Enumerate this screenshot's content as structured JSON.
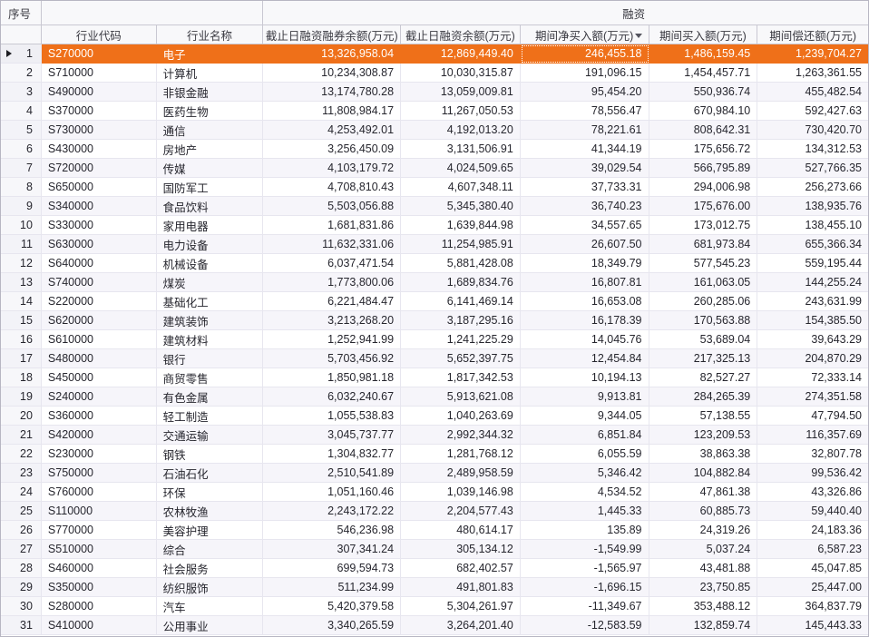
{
  "header": {
    "index_label": "序号",
    "financing_band_label": "融资",
    "columns": [
      {
        "label": "行业代码"
      },
      {
        "label": "行业名称"
      },
      {
        "label": "截止日融资融券余额(万元)"
      },
      {
        "label": "截止日融资余额(万元)"
      },
      {
        "label": "期间净买入额(万元)",
        "sort": "desc"
      },
      {
        "label": "期间买入额(万元)"
      },
      {
        "label": "期间偿还额(万元)"
      }
    ]
  },
  "colors": {
    "selection": "#ef7019",
    "alt_row_bg": "#f6f5fa",
    "header_bg": "#f8f8fa",
    "header_border": "#c9c8d2",
    "grid_line": "#e7e6ef"
  },
  "table": {
    "selected_row": 1,
    "focused_column_index": 4,
    "rows": [
      {
        "no": 1,
        "code": "S270000",
        "name": "电子",
        "v": [
          "13,326,958.04",
          "12,869,449.40",
          "246,455.18",
          "1,486,159.45",
          "1,239,704.27"
        ]
      },
      {
        "no": 2,
        "code": "S710000",
        "name": "计算机",
        "v": [
          "10,234,308.87",
          "10,030,315.87",
          "191,096.15",
          "1,454,457.71",
          "1,263,361.55"
        ]
      },
      {
        "no": 3,
        "code": "S490000",
        "name": "非银金融",
        "v": [
          "13,174,780.28",
          "13,059,009.81",
          "95,454.20",
          "550,936.74",
          "455,482.54"
        ]
      },
      {
        "no": 4,
        "code": "S370000",
        "name": "医药生物",
        "v": [
          "11,808,984.17",
          "11,267,050.53",
          "78,556.47",
          "670,984.10",
          "592,427.63"
        ]
      },
      {
        "no": 5,
        "code": "S730000",
        "name": "通信",
        "v": [
          "4,253,492.01",
          "4,192,013.20",
          "78,221.61",
          "808,642.31",
          "730,420.70"
        ]
      },
      {
        "no": 6,
        "code": "S430000",
        "name": "房地产",
        "v": [
          "3,256,450.09",
          "3,131,506.91",
          "41,344.19",
          "175,656.72",
          "134,312.53"
        ]
      },
      {
        "no": 7,
        "code": "S720000",
        "name": "传媒",
        "v": [
          "4,103,179.72",
          "4,024,509.65",
          "39,029.54",
          "566,795.89",
          "527,766.35"
        ]
      },
      {
        "no": 8,
        "code": "S650000",
        "name": "国防军工",
        "v": [
          "4,708,810.43",
          "4,607,348.11",
          "37,733.31",
          "294,006.98",
          "256,273.66"
        ]
      },
      {
        "no": 9,
        "code": "S340000",
        "name": "食品饮料",
        "v": [
          "5,503,056.88",
          "5,345,380.40",
          "36,740.23",
          "175,676.00",
          "138,935.76"
        ]
      },
      {
        "no": 10,
        "code": "S330000",
        "name": "家用电器",
        "v": [
          "1,681,831.86",
          "1,639,844.98",
          "34,557.65",
          "173,012.75",
          "138,455.10"
        ]
      },
      {
        "no": 11,
        "code": "S630000",
        "name": "电力设备",
        "v": [
          "11,632,331.06",
          "11,254,985.91",
          "26,607.50",
          "681,973.84",
          "655,366.34"
        ]
      },
      {
        "no": 12,
        "code": "S640000",
        "name": "机械设备",
        "v": [
          "6,037,471.54",
          "5,881,428.08",
          "18,349.79",
          "577,545.23",
          "559,195.44"
        ]
      },
      {
        "no": 13,
        "code": "S740000",
        "name": "煤炭",
        "v": [
          "1,773,800.06",
          "1,689,834.76",
          "16,807.81",
          "161,063.05",
          "144,255.24"
        ]
      },
      {
        "no": 14,
        "code": "S220000",
        "name": "基础化工",
        "v": [
          "6,221,484.47",
          "6,141,469.14",
          "16,653.08",
          "260,285.06",
          "243,631.99"
        ]
      },
      {
        "no": 15,
        "code": "S620000",
        "name": "建筑装饰",
        "v": [
          "3,213,268.20",
          "3,187,295.16",
          "16,178.39",
          "170,563.88",
          "154,385.50"
        ]
      },
      {
        "no": 16,
        "code": "S610000",
        "name": "建筑材料",
        "v": [
          "1,252,941.99",
          "1,241,225.29",
          "14,045.76",
          "53,689.04",
          "39,643.29"
        ]
      },
      {
        "no": 17,
        "code": "S480000",
        "name": "银行",
        "v": [
          "5,703,456.92",
          "5,652,397.75",
          "12,454.84",
          "217,325.13",
          "204,870.29"
        ]
      },
      {
        "no": 18,
        "code": "S450000",
        "name": "商贸零售",
        "v": [
          "1,850,981.18",
          "1,817,342.53",
          "10,194.13",
          "82,527.27",
          "72,333.14"
        ]
      },
      {
        "no": 19,
        "code": "S240000",
        "name": "有色金属",
        "v": [
          "6,032,240.67",
          "5,913,621.08",
          "9,913.81",
          "284,265.39",
          "274,351.58"
        ]
      },
      {
        "no": 20,
        "code": "S360000",
        "name": "轻工制造",
        "v": [
          "1,055,538.83",
          "1,040,263.69",
          "9,344.05",
          "57,138.55",
          "47,794.50"
        ]
      },
      {
        "no": 21,
        "code": "S420000",
        "name": "交通运输",
        "v": [
          "3,045,737.77",
          "2,992,344.32",
          "6,851.84",
          "123,209.53",
          "116,357.69"
        ]
      },
      {
        "no": 22,
        "code": "S230000",
        "name": "钢铁",
        "v": [
          "1,304,832.77",
          "1,281,768.12",
          "6,055.59",
          "38,863.38",
          "32,807.78"
        ]
      },
      {
        "no": 23,
        "code": "S750000",
        "name": "石油石化",
        "v": [
          "2,510,541.89",
          "2,489,958.59",
          "5,346.42",
          "104,882.84",
          "99,536.42"
        ]
      },
      {
        "no": 24,
        "code": "S760000",
        "name": "环保",
        "v": [
          "1,051,160.46",
          "1,039,146.98",
          "4,534.52",
          "47,861.38",
          "43,326.86"
        ]
      },
      {
        "no": 25,
        "code": "S110000",
        "name": "农林牧渔",
        "v": [
          "2,243,172.22",
          "2,204,577.43",
          "1,445.33",
          "60,885.73",
          "59,440.40"
        ]
      },
      {
        "no": 26,
        "code": "S770000",
        "name": "美容护理",
        "v": [
          "546,236.98",
          "480,614.17",
          "135.89",
          "24,319.26",
          "24,183.36"
        ]
      },
      {
        "no": 27,
        "code": "S510000",
        "name": "综合",
        "v": [
          "307,341.24",
          "305,134.12",
          "-1,549.99",
          "5,037.24",
          "6,587.23"
        ]
      },
      {
        "no": 28,
        "code": "S460000",
        "name": "社会服务",
        "v": [
          "699,594.73",
          "682,402.57",
          "-1,565.97",
          "43,481.88",
          "45,047.85"
        ]
      },
      {
        "no": 29,
        "code": "S350000",
        "name": "纺织服饰",
        "v": [
          "511,234.99",
          "491,801.83",
          "-1,696.15",
          "23,750.85",
          "25,447.00"
        ]
      },
      {
        "no": 30,
        "code": "S280000",
        "name": "汽车",
        "v": [
          "5,420,379.58",
          "5,304,261.97",
          "-11,349.67",
          "353,488.12",
          "364,837.79"
        ]
      },
      {
        "no": 31,
        "code": "S410000",
        "name": "公用事业",
        "v": [
          "3,340,265.59",
          "3,264,201.40",
          "-12,583.59",
          "132,859.74",
          "145,443.33"
        ]
      }
    ]
  }
}
